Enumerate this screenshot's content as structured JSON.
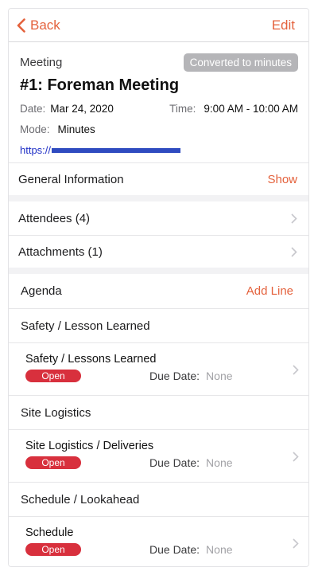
{
  "nav": {
    "back_label": "Back",
    "edit_label": "Edit"
  },
  "meeting": {
    "type": "Meeting",
    "badge": "Converted to minutes",
    "title": "#1: Foreman Meeting",
    "date_label": "Date:",
    "date": "Mar 24, 2020",
    "time_label": "Time:",
    "time": "9:00 AM - 10:00 AM",
    "mode_label": "Mode:",
    "mode": "Minutes",
    "link_prefix": "https://"
  },
  "general": {
    "label": "General Information",
    "action": "Show"
  },
  "attendees": {
    "label": "Attendees (4)"
  },
  "attachments": {
    "label": "Attachments (1)"
  },
  "agenda": {
    "label": "Agenda",
    "action": "Add Line"
  },
  "sections": [
    {
      "title": "Safety / Lesson Learned",
      "item": {
        "title": "Safety / Lessons Learned",
        "status": "Open",
        "due_label": "Due Date:",
        "due_value": "None"
      }
    },
    {
      "title": "Site Logistics",
      "item": {
        "title": "Site Logistics / Deliveries",
        "status": "Open",
        "due_label": "Due Date:",
        "due_value": "None"
      }
    },
    {
      "title": "Schedule / Lookahead",
      "item": {
        "title": "Schedule",
        "status": "Open",
        "due_label": "Due Date:",
        "due_value": "None"
      }
    }
  ],
  "colors": {
    "accent": "#e4623d",
    "status_open": "#d8303d",
    "badge_bg": "#b5b5b8",
    "link": "#1f2fc6"
  }
}
